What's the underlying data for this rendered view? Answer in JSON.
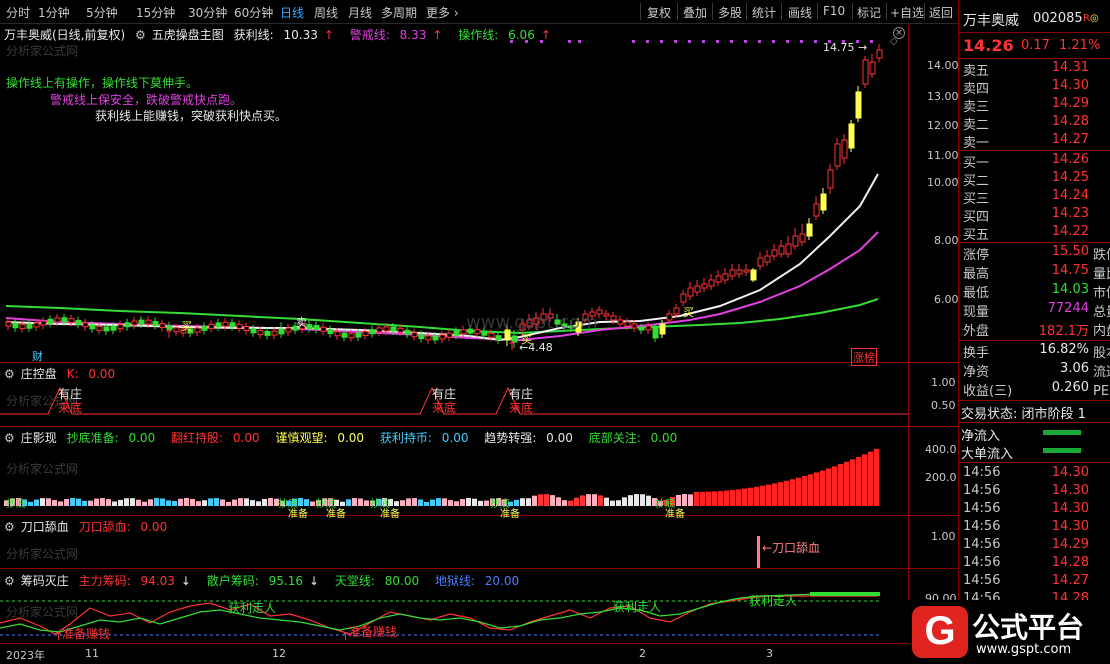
{
  "toolbar": {
    "periods": [
      "分时",
      "1分钟",
      "5分钟",
      "15分钟",
      "30分钟",
      "60分钟",
      "日线",
      "周线",
      "月线",
      "多周期",
      "更多"
    ],
    "active_period": "日线",
    "more_arrow": "›",
    "right_buttons": [
      "复权",
      "叠加",
      "多股",
      "统计",
      "画线",
      "F10",
      "标记",
      "+自选",
      "返回"
    ]
  },
  "main_panel": {
    "title": "万丰奥威(日线,前复权)",
    "indicator": "五虎操盘主图",
    "lines": [
      {
        "label": "获利线:",
        "value": "10.33",
        "arrow": "↑",
        "color": "#e8e8e8"
      },
      {
        "label": "警戒线:",
        "value": "8.33",
        "arrow": "↑",
        "color": "#e040e0"
      },
      {
        "label": "操作线:",
        "value": "6.06",
        "arrow": "↑",
        "color": "#33dd33"
      }
    ],
    "watermark": "分析家公式网",
    "note1": "操作线上有操作，操作线下莫伸手。",
    "note2": "警戒线上保安全，跌破警戒快点跑。",
    "note3": "获利线上能赚钱，突破获利快点买。",
    "high_label": "14.75",
    "low_label": "4.48",
    "buy_label": "买",
    "sell_label": "卖",
    "cai_label": "财",
    "zhangbang_label": "涨榜",
    "site_watermark": "www.gspt.com",
    "yticks": [
      "14.00",
      "13.00",
      "12.00",
      "11.00",
      "10.00",
      "8.00",
      "6.00"
    ]
  },
  "panel_zhuangkong": {
    "title": "庄控盘",
    "k_label": "K:",
    "k_value": "0.00",
    "watermark": "分析家公式网",
    "tag_top": "有庄",
    "tag_bottom": "来底",
    "yticks": [
      "1.00",
      "0.50"
    ]
  },
  "panel_zhuangying": {
    "title": "庄影现",
    "items": [
      {
        "label": "抄底准备:",
        "value": "0.00",
        "color": "#33dd33"
      },
      {
        "label": "翻红持股:",
        "value": "0.00",
        "color": "#ff3333"
      },
      {
        "label": "谨慎观望:",
        "value": "0.00",
        "color": "#ffff55"
      },
      {
        "label": "获利持币:",
        "value": "0.00",
        "color": "#44ccff"
      },
      {
        "label": "趋势转强:",
        "value": "0.00",
        "color": "#e8e8e8"
      },
      {
        "label": "底部关注:",
        "value": "0.00",
        "color": "#33dd33"
      }
    ],
    "watermark": "分析家公式网",
    "tag": "抄底",
    "tag2": "准备",
    "yticks": [
      "400.0",
      "200.0"
    ]
  },
  "panel_daokou": {
    "title": "刀口舔血",
    "item_label": "刀口舔血:",
    "item_value": "0.00",
    "watermark": "分析家公式网",
    "signal_label": "←刀口舔血",
    "yticks": [
      "1.00"
    ]
  },
  "panel_chouma": {
    "title": "筹码灭庄",
    "items": [
      {
        "label": "主力筹码:",
        "value": "94.03",
        "arrow": "↓",
        "color": "#ff3333"
      },
      {
        "label": "散户筹码:",
        "value": "95.16",
        "arrow": "↓",
        "color": "#33dd33"
      },
      {
        "label": "天堂线:",
        "value": "80.00",
        "arrow": "",
        "color": "#33dd33"
      },
      {
        "label": "地狱线:",
        "value": "20.00",
        "arrow": "",
        "color": "#4d7dff"
      }
    ],
    "watermark": "分析家公式网",
    "tag_profit": "获利走人",
    "tag_buy": "准备赚钱",
    "yticks": [
      "90.00"
    ]
  },
  "xaxis": [
    "2023年",
    "11",
    "12",
    "2",
    "3"
  ],
  "quote": {
    "name": "万丰奥威",
    "code": "002085",
    "rflag": "R",
    "price": "14.26",
    "change": "0.17",
    "pct": "1.21%",
    "sells": [
      {
        "label": "卖五",
        "price": "14.31"
      },
      {
        "label": "卖四",
        "price": "14.30"
      },
      {
        "label": "卖三",
        "price": "14.29"
      },
      {
        "label": "卖二",
        "price": "14.28"
      },
      {
        "label": "卖一",
        "price": "14.27"
      }
    ],
    "buys": [
      {
        "label": "买一",
        "price": "14.26"
      },
      {
        "label": "买二",
        "price": "14.25"
      },
      {
        "label": "买三",
        "price": "14.24"
      },
      {
        "label": "买四",
        "price": "14.23"
      },
      {
        "label": "买五",
        "price": "14.22"
      }
    ],
    "stats1": [
      {
        "label": "涨停",
        "value": "15.50",
        "color": "#ff3333",
        "extra": "跌停"
      },
      {
        "label": "最高",
        "value": "14.75",
        "color": "#ff3333",
        "extra": "量比"
      },
      {
        "label": "最低",
        "value": "14.03",
        "color": "#33dd33",
        "extra": "市值"
      },
      {
        "label": "现量",
        "value": "77244",
        "color": "#e040e0",
        "extra": "总量"
      },
      {
        "label": "外盘",
        "value": "182.1万",
        "color": "#ff3333",
        "extra": "内盘"
      }
    ],
    "stats2": [
      {
        "label": "换手",
        "value": "16.82%",
        "color": "#e8e8e8",
        "extra": "股本"
      },
      {
        "label": "净资",
        "value": "3.06",
        "color": "#e8e8e8",
        "extra": "流通"
      },
      {
        "label": "收益(三)",
        "value": "0.260",
        "color": "#e8e8e8",
        "extra": "PE(动"
      }
    ],
    "trade_status": "交易状态: 闭市阶段 1",
    "net_inflow": "净流入",
    "big_inflow": "大单流入",
    "ticks": [
      {
        "time": "14:56",
        "price": "14.30"
      },
      {
        "time": "14:56",
        "price": "14.30"
      },
      {
        "time": "14:56",
        "price": "14.30"
      },
      {
        "time": "14:56",
        "price": "14.30"
      },
      {
        "time": "14:56",
        "price": "14.29"
      },
      {
        "time": "14:56",
        "price": "14.28"
      },
      {
        "time": "14:56",
        "price": "14.27"
      },
      {
        "time": "14:56",
        "price": "14.28"
      }
    ]
  },
  "logo": {
    "text": "公式平台",
    "url": "www.gspt.com",
    "mark": "G"
  }
}
